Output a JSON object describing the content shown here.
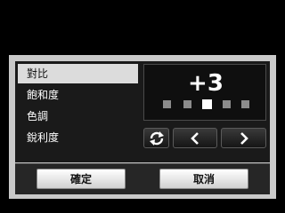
{
  "settings": {
    "items": [
      {
        "label": "對比",
        "selected": true
      },
      {
        "label": "飽和度",
        "selected": false
      },
      {
        "label": "色調",
        "selected": false
      },
      {
        "label": "銳利度",
        "selected": false
      }
    ]
  },
  "value_panel": {
    "value": "+3",
    "level_count": 5,
    "active_level_index": 2
  },
  "controls": {
    "reset_icon": "reset-cycle-icon",
    "prev_icon": "chevron-left-icon",
    "next_icon": "chevron-right-icon"
  },
  "footer": {
    "ok_label": "確定",
    "cancel_label": "取消"
  },
  "colors": {
    "frame": "#c9c9c9",
    "body": "#1a1a1a",
    "selected_row": "#dcdcdc",
    "active_dot": "#ffffff",
    "inactive_dot": "#8c8c8c"
  }
}
